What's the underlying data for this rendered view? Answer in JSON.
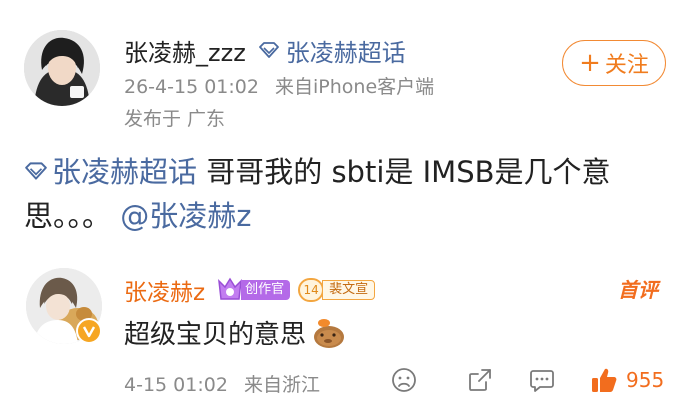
{
  "post": {
    "author_name": "张凌赫_zzz",
    "topic_link": "张凌赫超话",
    "time": "26-4-15 01:02",
    "source": "来自iPhone客户端",
    "location": "发布于 广东",
    "follow_label": "关注",
    "body": {
      "topic": "张凌赫超话",
      "text": " 哥哥我的 sbti是 IMSB是几个意思。。。",
      "mention": "@张凌赫z"
    }
  },
  "comment": {
    "author_name": "张凌赫z",
    "creator_badge": "创作官",
    "fan_level": "14",
    "fan_badge": "裴文宣",
    "top_label": "首评",
    "text": "超级宝贝的意思",
    "time": "4-15 01:02",
    "source": "来自浙江",
    "like_count": "955"
  },
  "colors": {
    "accent_orange": "#f07c1e",
    "link_blue": "#4a6aa0",
    "meta_gray": "#8a8a8a"
  },
  "icons": [
    "topic-diamond-icon",
    "plus-icon",
    "dislike-face-icon",
    "share-icon",
    "comment-icon",
    "like-thumb-icon",
    "vip-badge-icon",
    "capybara-emoji"
  ]
}
